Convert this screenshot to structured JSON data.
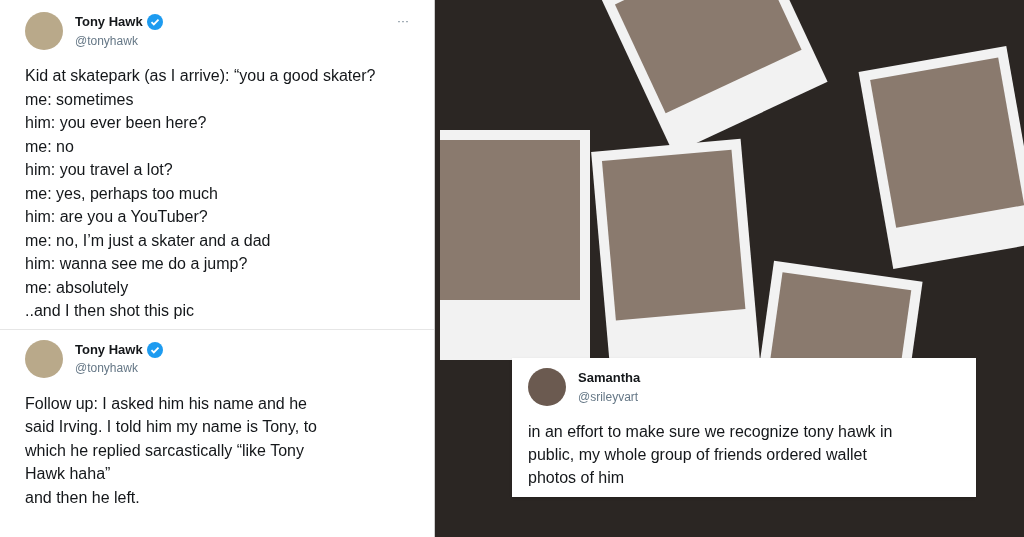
{
  "tweets": [
    {
      "name": "Tony Hawk",
      "handle": "@tonyhawk",
      "verified": true,
      "menu": "···",
      "lines": [
        "Kid at skatepark (as I arrive): “you a good skater?",
        "me: sometimes",
        "him: you ever been here?",
        "me: no",
        "him: you travel a lot?",
        "me: yes, perhaps too much",
        "him: are you a YouTuber?",
        "me: no, I’m just a skater and a dad",
        "him: wanna see me do a jump?",
        "me: absolutely",
        "..and I then shot this pic"
      ]
    },
    {
      "name": "Tony Hawk",
      "handle": "@tonyhawk",
      "verified": true,
      "lines": [
        "Follow up: I asked him his name and he",
        "said Irving. I told him my name is Tony, to",
        "which he replied sarcastically “like Tony",
        "Hawk haha”",
        "and then he left."
      ]
    }
  ],
  "overlay_tweet": {
    "name": "Samantha",
    "handle": "@srileyvart",
    "lines": [
      "in an effort to make sure we recognize tony hawk in",
      "public, my whole group of friends ordered wallet",
      "photos of him"
    ]
  }
}
